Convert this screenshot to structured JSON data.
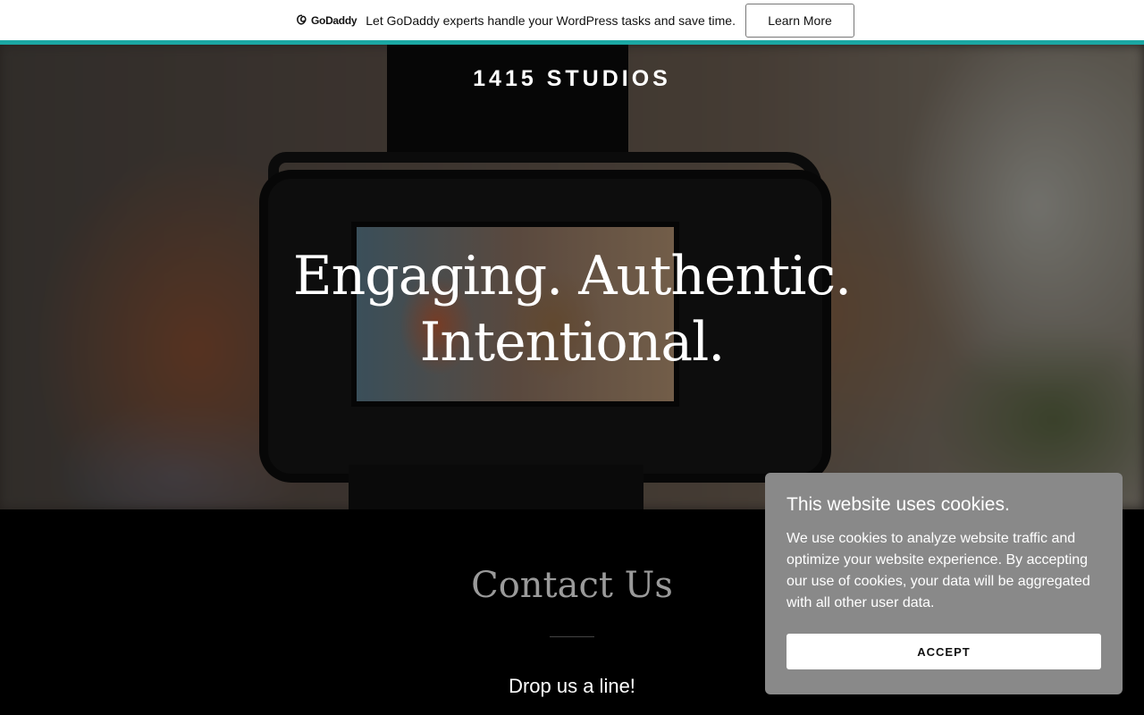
{
  "promo": {
    "logo_text": "GoDaddy",
    "message": "Let GoDaddy experts handle your WordPress tasks and save time.",
    "button_label": "Learn More",
    "accent_color": "#1ba7a3"
  },
  "hero": {
    "brand": "1415 STUDIOS",
    "headline_line1": "Engaging. Authentic.",
    "headline_line2": "Intentional."
  },
  "contact": {
    "title": "Contact Us",
    "subtitle": "Drop us a line!"
  },
  "cookie_banner": {
    "title": "This website uses cookies.",
    "body": "We use cookies to analyze website traffic and optimize your website experience. By accepting our use of cookies, your data will be aggregated with all other user data.",
    "accept_label": "ACCEPT"
  }
}
